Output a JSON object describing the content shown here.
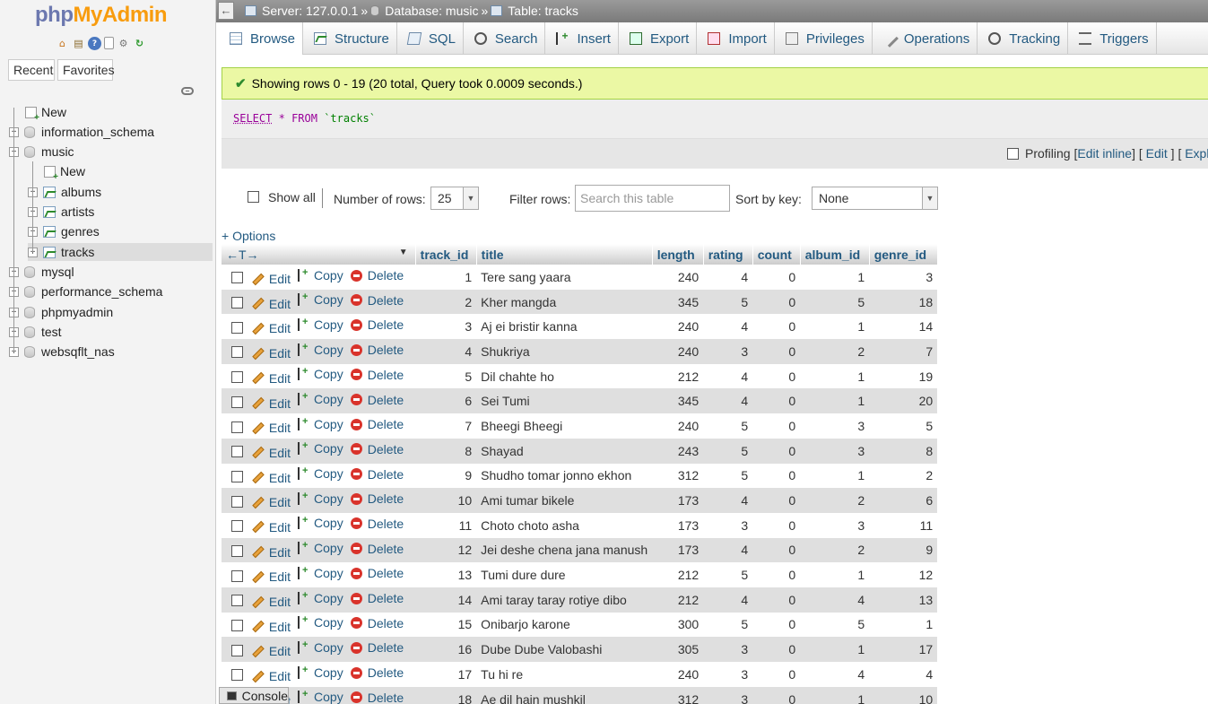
{
  "logo": {
    "part1": "php",
    "part2": "MyAdmin"
  },
  "nav": {
    "recent": "Recent",
    "favorites": "Favorites",
    "tree": [
      {
        "label": "New",
        "kind": "new",
        "level": 1
      },
      {
        "label": "information_schema",
        "kind": "db",
        "level": 1
      },
      {
        "label": "music",
        "kind": "db",
        "level": 1
      },
      {
        "label": "New",
        "kind": "new",
        "level": 2
      },
      {
        "label": "albums",
        "kind": "table",
        "level": 2
      },
      {
        "label": "artists",
        "kind": "table",
        "level": 2
      },
      {
        "label": "genres",
        "kind": "table",
        "level": 2
      },
      {
        "label": "tracks",
        "kind": "table",
        "level": 2
      },
      {
        "label": "mysql",
        "kind": "db",
        "level": 1
      },
      {
        "label": "performance_schema",
        "kind": "db",
        "level": 1
      },
      {
        "label": "phpmyadmin",
        "kind": "db",
        "level": 1
      },
      {
        "label": "test",
        "kind": "db",
        "level": 1
      },
      {
        "label": "websqflt_nas",
        "kind": "db",
        "level": 1
      }
    ]
  },
  "breadcrumb": {
    "server": "Server: 127.0.0.1",
    "sep1": "»",
    "database": "Database: music",
    "sep2": "»",
    "table": "Table: tracks"
  },
  "tabs": [
    "Browse",
    "Structure",
    "SQL",
    "Search",
    "Insert",
    "Export",
    "Import",
    "Privileges",
    "Operations",
    "Tracking",
    "Triggers"
  ],
  "message": "Showing rows 0 - 19 (20 total, Query took 0.0009 seconds.)",
  "query": {
    "select": "SELECT",
    "star": "*",
    "from": "FROM",
    "table": "`tracks`"
  },
  "profiling": {
    "label": "Profiling",
    "open1": "[",
    "edit_inline": "Edit inline",
    "close1": "]",
    "open2": "[",
    "edit": "Edit",
    "close2": "]",
    "open3": "[",
    "explain": "Explai"
  },
  "filters": {
    "show_all": "Show all",
    "num_rows_label": "Number of rows:",
    "num_rows_value": "25",
    "filter_label": "Filter rows:",
    "filter_placeholder": "Search this table",
    "sort_label": "Sort by key:",
    "sort_value": "None"
  },
  "options_link": "+ Options",
  "resize_arrows": "←T→",
  "actions": {
    "edit": "Edit",
    "copy": "Copy",
    "delete": "Delete"
  },
  "columns": [
    "track_id",
    "title",
    "length",
    "rating",
    "count",
    "album_id",
    "genre_id"
  ],
  "rows": [
    [
      1,
      "Tere sang yaara",
      240,
      4,
      0,
      1,
      3
    ],
    [
      2,
      "Kher mangda",
      345,
      5,
      0,
      5,
      18
    ],
    [
      3,
      "Aj ei bristir kanna",
      240,
      4,
      0,
      1,
      14
    ],
    [
      4,
      "Shukriya",
      240,
      3,
      0,
      2,
      7
    ],
    [
      5,
      "Dil chahte ho",
      212,
      4,
      0,
      1,
      19
    ],
    [
      6,
      "Sei Tumi",
      345,
      4,
      0,
      1,
      20
    ],
    [
      7,
      "Bheegi Bheegi",
      240,
      5,
      0,
      3,
      5
    ],
    [
      8,
      "Shayad",
      243,
      5,
      0,
      3,
      8
    ],
    [
      9,
      "Shudho tomar jonno ekhon",
      312,
      5,
      0,
      1,
      2
    ],
    [
      10,
      "Ami tumar bikele",
      173,
      4,
      0,
      2,
      6
    ],
    [
      11,
      "Choto choto asha",
      173,
      3,
      0,
      3,
      11
    ],
    [
      12,
      "Jei deshe chena jana manush",
      173,
      4,
      0,
      2,
      9
    ],
    [
      13,
      "Tumi dure dure",
      212,
      5,
      0,
      1,
      12
    ],
    [
      14,
      "Ami taray taray rotiye dibo",
      212,
      4,
      0,
      4,
      13
    ],
    [
      15,
      "Onibarjo karone",
      300,
      5,
      0,
      5,
      1
    ],
    [
      16,
      "Dube Dube Valobashi",
      305,
      3,
      0,
      1,
      17
    ],
    [
      17,
      "Tu hi re",
      240,
      3,
      0,
      4,
      4
    ],
    [
      18,
      "Ae dil hain mushkil",
      312,
      3,
      0,
      1,
      10
    ]
  ],
  "console": "Console"
}
